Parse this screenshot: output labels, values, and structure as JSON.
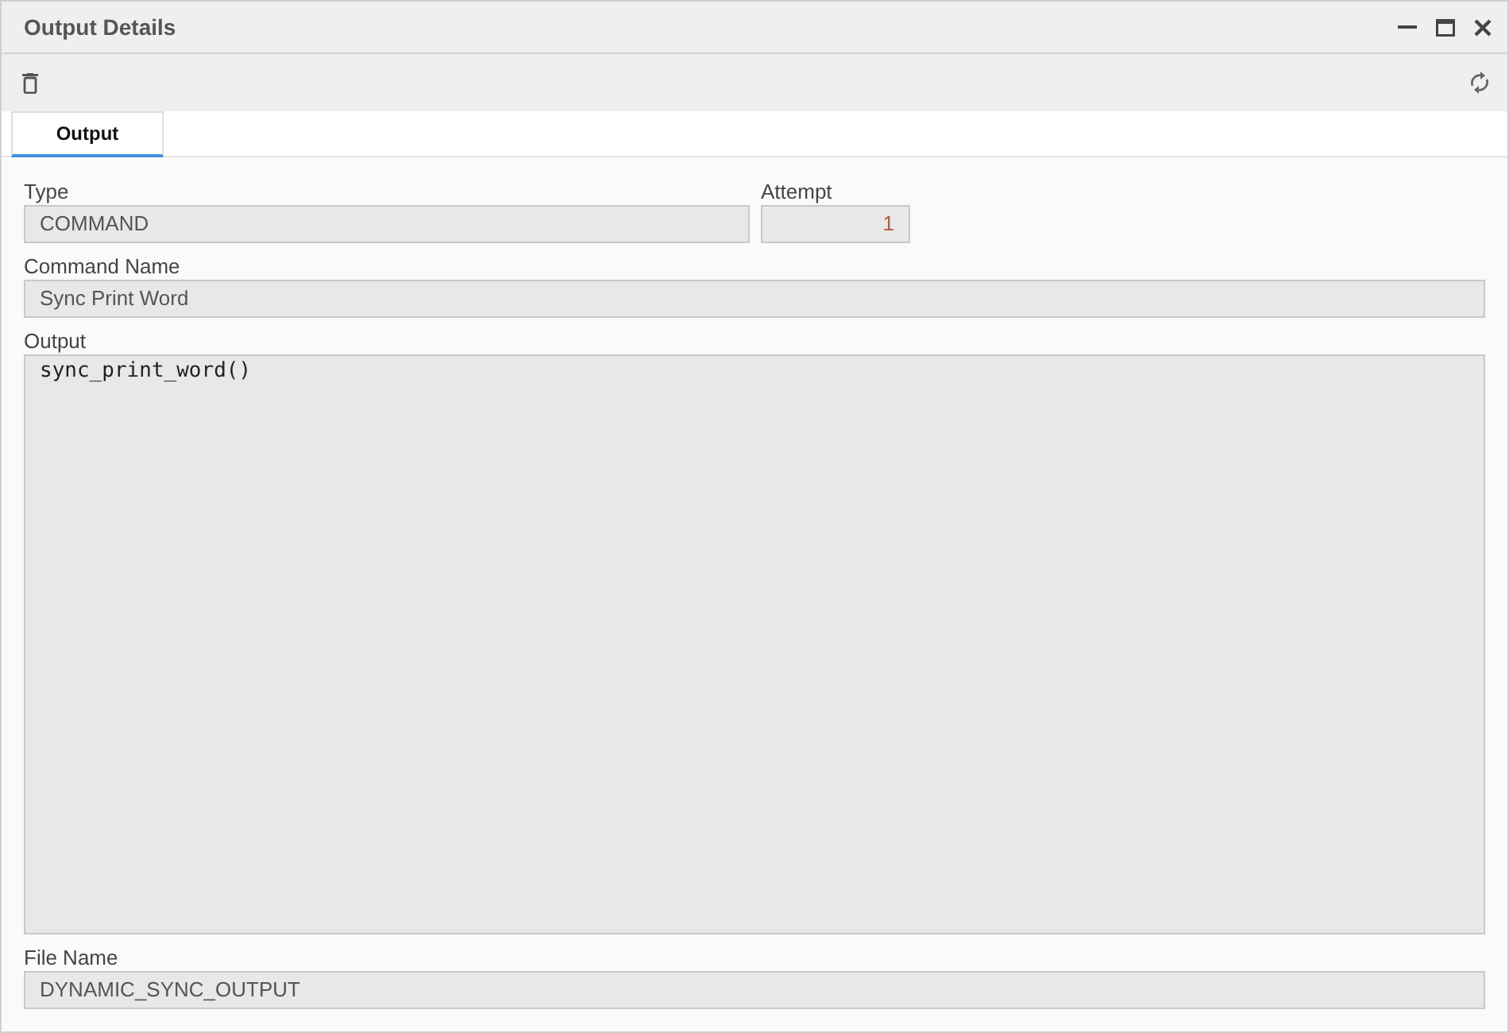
{
  "window": {
    "title": "Output Details"
  },
  "tabs": [
    {
      "label": "Output",
      "selected": true
    }
  ],
  "type": {
    "label": "Type",
    "value": "COMMAND"
  },
  "attempt": {
    "label": "Attempt",
    "value": "1"
  },
  "command_name": {
    "label": "Command Name",
    "value": "Sync Print Word"
  },
  "output": {
    "label": "Output",
    "value": "sync_print_word()"
  },
  "file_name": {
    "label": "File Name",
    "value": "DYNAMIC_SYNC_OUTPUT"
  }
}
